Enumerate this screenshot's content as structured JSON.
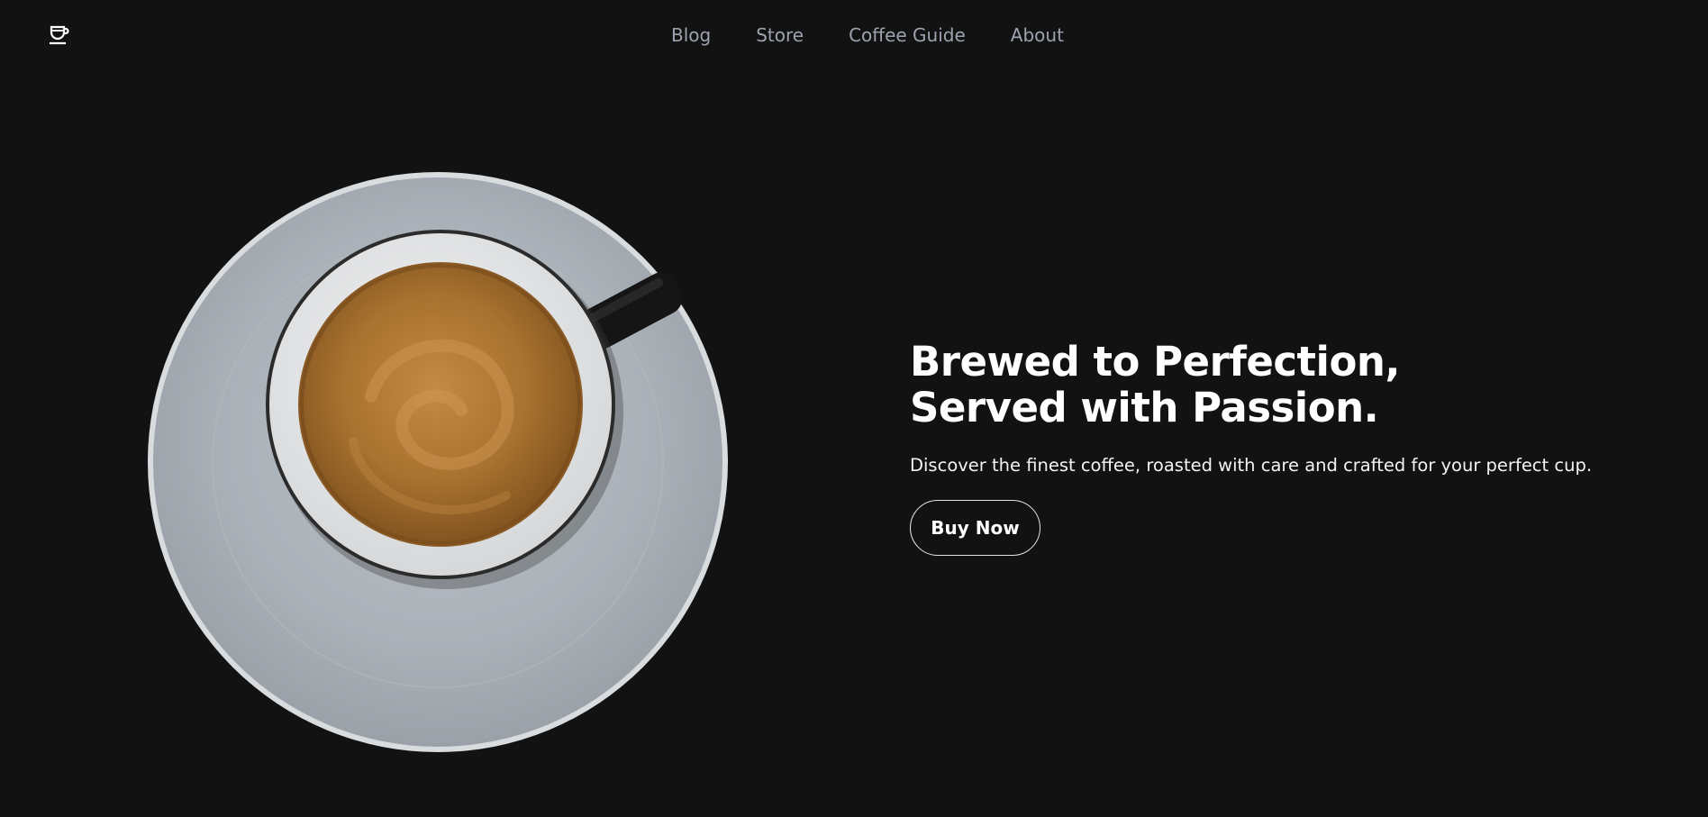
{
  "header": {
    "logo_icon": "coffee-cup-icon",
    "nav": [
      {
        "label": "Blog"
      },
      {
        "label": "Store"
      },
      {
        "label": "Coffee Guide"
      },
      {
        "label": "About"
      }
    ]
  },
  "hero": {
    "image": "coffee-cup-top-view",
    "headline_line1": "Brewed to Perfection,",
    "headline_line2": "Served with Passion.",
    "subtext": "Discover the finest coffee, roasted with care and crafted for your perfect cup.",
    "cta_label": "Buy Now"
  },
  "colors": {
    "background": "#121212",
    "nav_text": "#9ca3af",
    "text": "#ffffff",
    "saucer": "#a9b0b7",
    "coffee": "#a8722f"
  }
}
